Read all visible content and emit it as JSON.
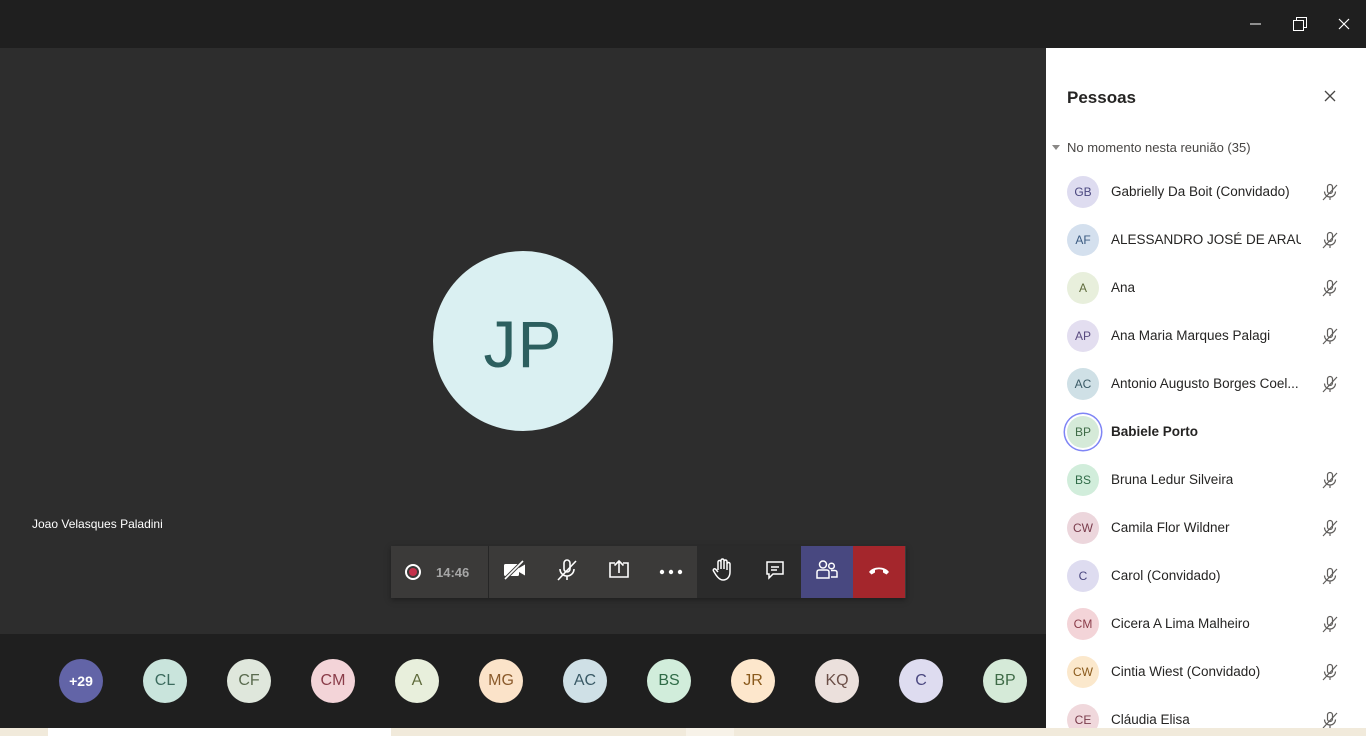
{
  "window": {
    "controls": [
      "minimize",
      "restore",
      "close"
    ]
  },
  "stage": {
    "main_participant": {
      "initials": "JP",
      "name": "Joao Velasques Paladini",
      "avatar_bg": "#daf0f2",
      "avatar_fg": "#2c5f5f"
    }
  },
  "call_controls": {
    "timer": "14:46",
    "buttons": [
      {
        "id": "camera",
        "icon": "camera-off-icon"
      },
      {
        "id": "mic",
        "icon": "mic-off-icon"
      },
      {
        "id": "share",
        "icon": "share-screen-icon"
      },
      {
        "id": "more",
        "icon": "more-actions-icon"
      },
      {
        "id": "raise-hand",
        "icon": "raise-hand-icon"
      },
      {
        "id": "chat",
        "icon": "chat-icon"
      },
      {
        "id": "people",
        "icon": "people-icon",
        "active": true
      },
      {
        "id": "hangup",
        "icon": "hang-up-icon"
      }
    ],
    "colors": {
      "bar": "#3b3a39",
      "people_active": "#484880",
      "hangup": "#a4262c"
    }
  },
  "strip": {
    "overflow_label": "+29",
    "avatars": [
      {
        "initials": "CL",
        "bg": "#c9e4dc",
        "fg": "#3c6b5e"
      },
      {
        "initials": "CF",
        "bg": "#dfe7dc",
        "fg": "#5a6b4f"
      },
      {
        "initials": "CM",
        "bg": "#f3d4d8",
        "fg": "#8a3c49"
      },
      {
        "initials": "A",
        "bg": "#e8efdc",
        "fg": "#5f6b3c"
      },
      {
        "initials": "MG",
        "bg": "#fbe3c9",
        "fg": "#8a5a2b"
      },
      {
        "initials": "AC",
        "bg": "#cfe0e6",
        "fg": "#3a5a66"
      },
      {
        "initials": "BS",
        "bg": "#d1eddb",
        "fg": "#2f6b47"
      },
      {
        "initials": "JR",
        "bg": "#fde7cc",
        "fg": "#8a5a1c"
      },
      {
        "initials": "KQ",
        "bg": "#ebe0dc",
        "fg": "#6b4f47"
      },
      {
        "initials": "C",
        "bg": "#dedcf0",
        "fg": "#4b4880"
      },
      {
        "initials": "BP",
        "bg": "#d5ead8",
        "fg": "#3f6b47"
      }
    ]
  },
  "people_panel": {
    "title": "Pessoas",
    "section_label": "No momento nesta reunião (35)",
    "people": [
      {
        "initials": "GB",
        "name": "Gabrielly Da Boit (Convidado)",
        "bg": "#dedcf0",
        "fg": "#4b4880",
        "muted": true,
        "speaking": false
      },
      {
        "initials": "AF",
        "name": "ALESSANDRO JOSÉ DE ARAUJ...",
        "bg": "#d4e0ee",
        "fg": "#3a5a80",
        "muted": true,
        "speaking": false
      },
      {
        "initials": "A",
        "name": "Ana",
        "bg": "#e8efdc",
        "fg": "#5f6b3c",
        "muted": true,
        "speaking": false
      },
      {
        "initials": "AP",
        "name": "Ana Maria Marques Palagi",
        "bg": "#e3def0",
        "fg": "#5a4b80",
        "muted": true,
        "speaking": false
      },
      {
        "initials": "AC",
        "name": "Antonio Augusto Borges Coel...",
        "bg": "#cfe0e6",
        "fg": "#3a5a66",
        "muted": true,
        "speaking": false
      },
      {
        "initials": "BP",
        "name": "Babiele Porto",
        "bg": "#d5ead8",
        "fg": "#3f6b47",
        "muted": false,
        "speaking": true
      },
      {
        "initials": "BS",
        "name": "Bruna Ledur Silveira",
        "bg": "#d1eddb",
        "fg": "#2f6b47",
        "muted": true,
        "speaking": false
      },
      {
        "initials": "CW",
        "name": "Camila Flor Wildner",
        "bg": "#ecd6dc",
        "fg": "#7a3c4c",
        "muted": true,
        "speaking": false
      },
      {
        "initials": "C",
        "name": "Carol (Convidado)",
        "bg": "#dedcf0",
        "fg": "#4b4880",
        "muted": true,
        "speaking": false
      },
      {
        "initials": "CM",
        "name": "Cicera A Lima Malheiro",
        "bg": "#f3d4d8",
        "fg": "#8a3c49",
        "muted": true,
        "speaking": false
      },
      {
        "initials": "CW",
        "name": "Cintia Wiest (Convidado)",
        "bg": "#fbe8cc",
        "fg": "#8a5a1c",
        "muted": true,
        "speaking": false
      },
      {
        "initials": "CE",
        "name": "Cláudia Elisa",
        "bg": "#f0d8dc",
        "fg": "#7a3c4c",
        "muted": true,
        "speaking": false
      }
    ]
  }
}
